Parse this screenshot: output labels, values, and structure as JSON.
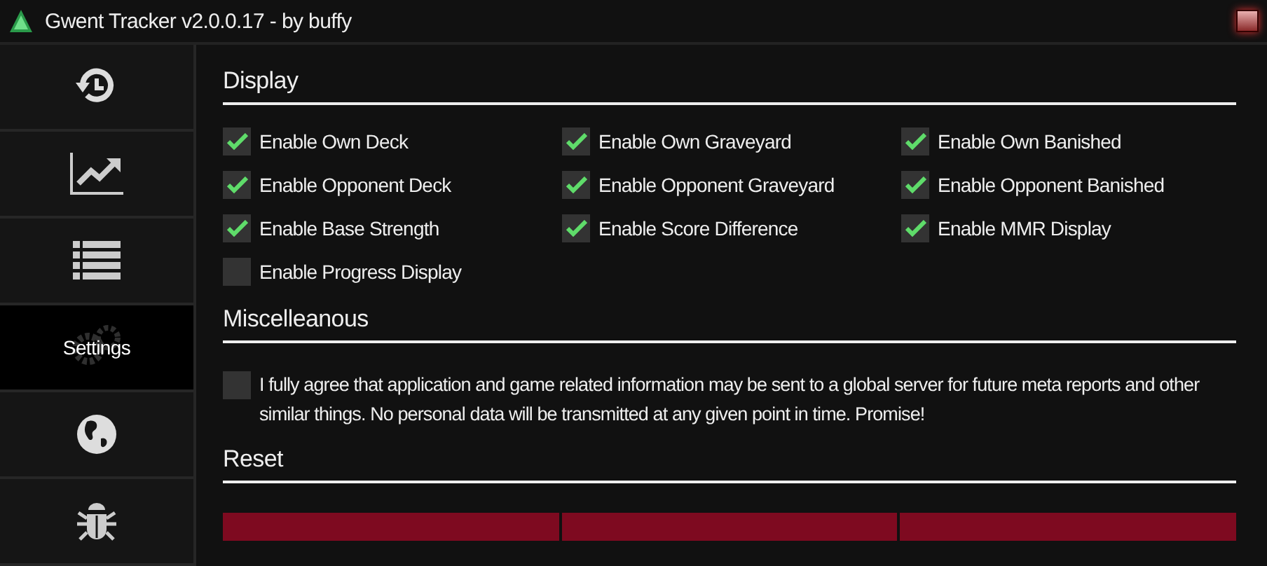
{
  "window": {
    "title": "Gwent Tracker v2.0.0.17 - by buffy"
  },
  "sidebar": {
    "items": [
      {
        "kind": "history",
        "selected": false
      },
      {
        "kind": "stats",
        "selected": false
      },
      {
        "kind": "list",
        "selected": false
      },
      {
        "kind": "settings",
        "label": "Settings",
        "selected": true
      },
      {
        "kind": "globe",
        "selected": false
      },
      {
        "kind": "bug",
        "selected": false
      }
    ]
  },
  "sections": [
    {
      "title": "Display",
      "options": [
        {
          "label": "Enable Own Deck",
          "checked": true
        },
        {
          "label": "Enable Own Graveyard",
          "checked": true
        },
        {
          "label": "Enable Own Banished",
          "checked": true
        },
        {
          "label": "Enable Opponent Deck",
          "checked": true
        },
        {
          "label": "Enable Opponent Graveyard",
          "checked": true
        },
        {
          "label": "Enable Opponent Banished",
          "checked": true
        },
        {
          "label": "Enable Base Strength",
          "checked": true
        },
        {
          "label": "Enable Score Difference",
          "checked": true
        },
        {
          "label": "Enable MMR Display",
          "checked": true
        },
        {
          "label": "Enable Progress Display",
          "checked": false
        }
      ]
    },
    {
      "title": "Miscelleanous",
      "agreement": {
        "text": "I fully agree that application and game related information may be sent to a global server for future meta reports and other similar things. No personal data will be transmitted at any given point in time. Promise!",
        "checked": false
      }
    },
    {
      "title": "Reset",
      "buttons": [
        {
          "kind": "action"
        },
        {
          "kind": "action"
        },
        {
          "kind": "action"
        }
      ]
    }
  ]
}
